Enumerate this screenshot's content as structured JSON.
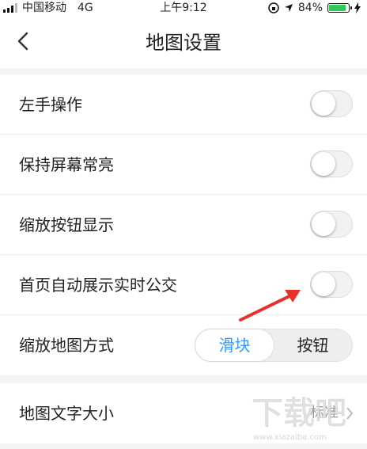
{
  "status_bar": {
    "carrier": "中国移动",
    "network": "4G",
    "time": "上午9:12",
    "battery_percent": "84%",
    "battery_level": 0.84,
    "battery_color": "#34c759"
  },
  "nav": {
    "title": "地图设置",
    "back_icon": "chevron-left-icon"
  },
  "settings": {
    "rows": [
      {
        "label": "左手操作",
        "toggle_on": false
      },
      {
        "label": "保持屏幕常亮",
        "toggle_on": false
      },
      {
        "label": "缩放按钮显示",
        "toggle_on": false
      },
      {
        "label": "首页自动展示实时公交",
        "toggle_on": false
      }
    ],
    "zoom_mode": {
      "label": "缩放地图方式",
      "options": [
        "滑块",
        "按钮"
      ],
      "selected": "滑块",
      "accent": "#3399ff"
    },
    "text_size": {
      "label": "地图文字大小",
      "value": "标准"
    }
  },
  "watermark": {
    "text": "下载吧",
    "url": "www.xiazaiba.com"
  },
  "annotation": {
    "arrow_color": "#e8312a"
  }
}
